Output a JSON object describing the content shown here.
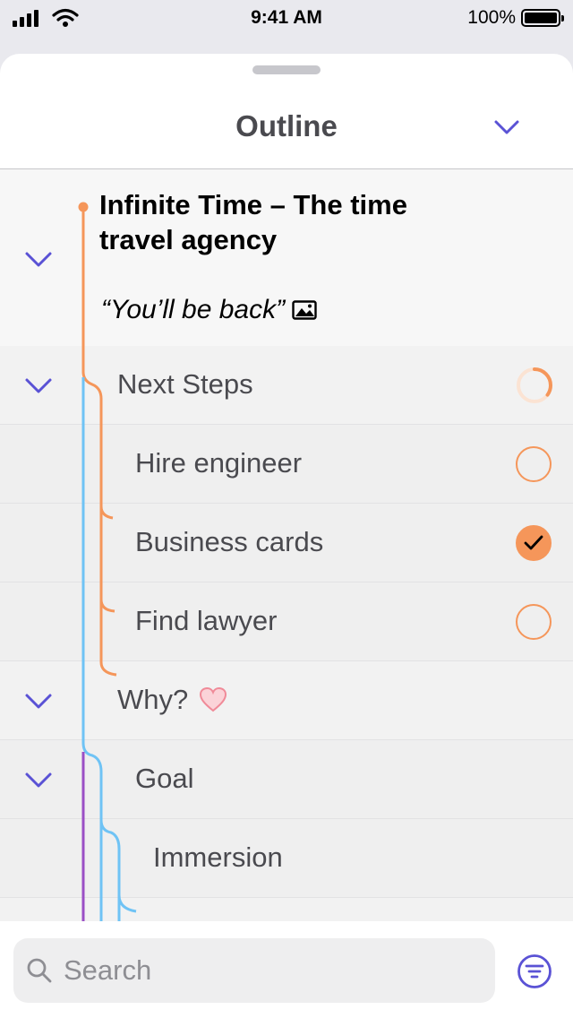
{
  "status_bar": {
    "time": "9:41 AM",
    "battery": "100%",
    "signal_icon": "signal-bars-icon",
    "wifi_icon": "wifi-icon",
    "battery_icon": "battery-full-icon"
  },
  "sheet": {
    "title": "Outline",
    "collapse_icon": "chevron-down-icon"
  },
  "outline": {
    "title": "Infinite Time – The time travel agency",
    "note": "“You’ll be back”",
    "note_icon": "image-icon",
    "items": [
      {
        "label": "Next Steps",
        "status": "in-progress",
        "progress": 0.35
      },
      {
        "label": "Hire engineer",
        "status": "open"
      },
      {
        "label": "Business cards",
        "status": "done"
      },
      {
        "label": "Find lawyer",
        "status": "open"
      },
      {
        "label": "Why?",
        "status": "none",
        "emoji": "heart-icon"
      },
      {
        "label": "Goal",
        "status": "none"
      },
      {
        "label": "Immersion",
        "status": "none"
      }
    ]
  },
  "search": {
    "placeholder": "Search",
    "search_icon": "search-icon",
    "filter_icon": "filter-icon"
  },
  "colors": {
    "accent": "#5a52d5",
    "task_orange": "#f5965a",
    "line_blue": "#6fc3f5",
    "line_purple": "#9b4fc5"
  }
}
